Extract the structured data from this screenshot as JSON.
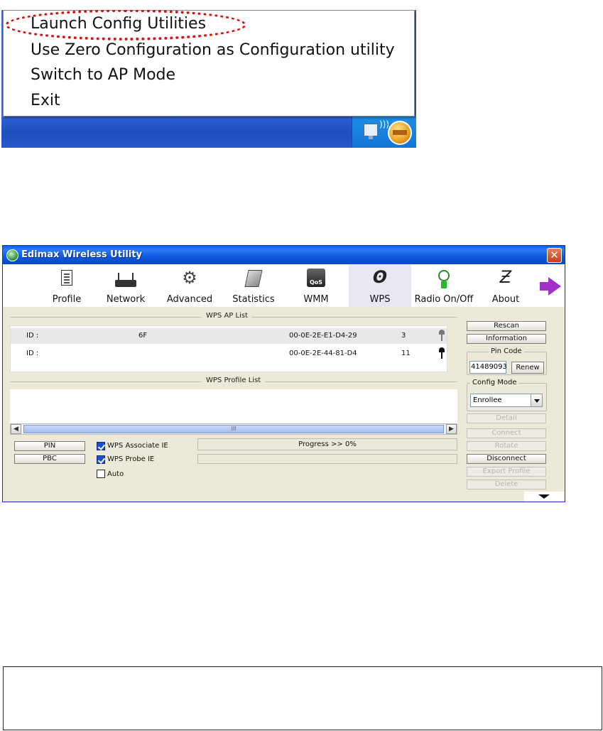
{
  "context_menu": {
    "items": [
      "Launch Config Utilities",
      "Use Zero Configuration as Configuration utility",
      "Switch to AP Mode",
      "Exit"
    ],
    "highlighted_item": "Launch Config Utilities",
    "highlight_color": "#dd1111"
  },
  "window": {
    "title": "Edimax Wireless Utility",
    "close_glyph": "✕"
  },
  "toolbar": {
    "tabs": [
      {
        "label": "Profile",
        "icon": "profile-icon"
      },
      {
        "label": "Network",
        "icon": "network-icon"
      },
      {
        "label": "Advanced",
        "icon": "advanced-gear-icon"
      },
      {
        "label": "Statistics",
        "icon": "statistics-icon"
      },
      {
        "label": "WMM",
        "icon": "qos-icon",
        "icon_text": "QoS"
      },
      {
        "label": "WPS",
        "icon": "wps-icon"
      },
      {
        "label": "Radio On/Off",
        "icon": "radio-icon"
      },
      {
        "label": "About",
        "icon": "about-icon"
      }
    ],
    "active_tab": "WPS"
  },
  "wps": {
    "ap_list_title": "WPS AP List",
    "ap_list": [
      {
        "id_label": "ID :",
        "ssid": "6F",
        "mac": "00-0E-2E-E1-D4-29",
        "channel": "3"
      },
      {
        "id_label": "ID :",
        "ssid": "",
        "mac": "00-0E-2E-44-81-D4",
        "channel": "11"
      }
    ],
    "profile_list_title": "WPS Profile List",
    "scroll_thumb_grip": "III",
    "pin_button": "PIN",
    "pbc_button": "PBC",
    "checkboxes": [
      {
        "label": "WPS Associate IE",
        "checked": true
      },
      {
        "label": "WPS Probe IE",
        "checked": true
      },
      {
        "label": "Auto",
        "checked": false
      }
    ],
    "progress_text": "Progress >> 0%",
    "progress_percent": 0
  },
  "side_panel": {
    "rescan": "Rescan",
    "information": "Information",
    "pin_code_label": "Pin Code",
    "pin_code_value": "41489093",
    "renew": "Renew",
    "config_mode_label": "Config Mode",
    "config_mode_value": "Enrollee",
    "detail": "Detail",
    "connect": "Connect",
    "rotate": "Rotate",
    "disconnect": "Disconnect",
    "export_profile": "Export Profile",
    "delete": "Delete"
  }
}
